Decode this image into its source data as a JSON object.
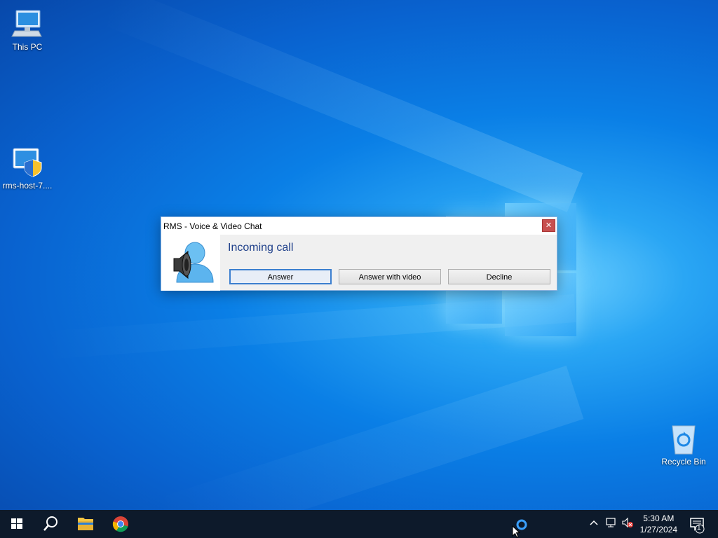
{
  "desktop": {
    "icons": [
      {
        "label": "This PC"
      },
      {
        "label": "rms-host-7...."
      },
      {
        "label": "Recycle Bin"
      }
    ]
  },
  "dialog": {
    "title": "RMS - Voice & Video Chat",
    "close_glyph": "✕",
    "heading": "Incoming call",
    "buttons": {
      "answer": "Answer",
      "answer_video": "Answer with video",
      "decline": "Decline"
    }
  },
  "taskbar": {
    "tray": {
      "time": "5:30 AM",
      "date": "1/27/2024",
      "notification_count": "1"
    }
  },
  "colors": {
    "accent": "#3c7fcf",
    "close": "#c75050",
    "heading": "#1e3f8a",
    "taskbar": "#0d1a2b"
  }
}
